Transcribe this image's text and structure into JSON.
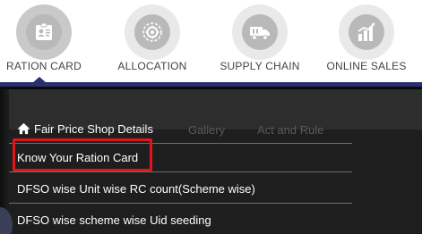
{
  "categories": [
    {
      "label": "RATION CARD",
      "icon": "id-card-icon",
      "active": true
    },
    {
      "label": "ALLOCATION",
      "icon": "gear-icon",
      "active": false
    },
    {
      "label": "SUPPLY CHAIN",
      "icon": "truck-icon",
      "active": false
    },
    {
      "label": "ONLINE SALES",
      "icon": "bar-chart-icon",
      "active": false
    }
  ],
  "menu": {
    "header": {
      "label": "Fair Price Shop Details",
      "icon": "home-icon"
    },
    "ghost_tabs": [
      "Gallery",
      "Act and Rule"
    ],
    "items": [
      {
        "label": "Know Your Ration Card",
        "highlighted": true
      },
      {
        "label": "DFSO wise Unit wise RC count(Scheme wise)"
      },
      {
        "label": "DFSO wise scheme wise Uid seeding"
      }
    ]
  },
  "colors": {
    "accent_line": "#2a2f6e",
    "panel_bg": "#1e1e1e",
    "highlight_border": "#e0151c",
    "category_label": "#444444"
  }
}
